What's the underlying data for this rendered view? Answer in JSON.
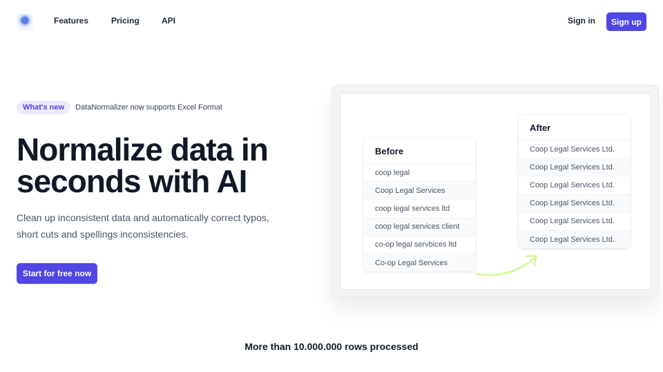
{
  "nav": {
    "links": [
      "Features",
      "Pricing",
      "API"
    ],
    "signin": "Sign in",
    "signup": "Sign up"
  },
  "hero": {
    "badge": "What's new",
    "announcement": "DataNormalizer now supports Excel Format",
    "headline_lines": [
      "Normalize data in",
      "seconds with AI"
    ],
    "subtext_lines": [
      "Clean up inconsistent data and automatically correct typos,",
      "short cuts and spellings inconsistencies."
    ],
    "cta": "Start for free now"
  },
  "demo": {
    "before": {
      "title": "Before",
      "rows": [
        "coop legal",
        "Coop Legal Services",
        "coop legal services ltd",
        "coop legal services client",
        "co-op legal servbices ltd",
        "Co-op Legal Services"
      ]
    },
    "after": {
      "title": "After",
      "rows": [
        "Coop Legal Services Ltd.",
        "Coop Legal Services Ltd.",
        "Coop Legal Services Ltd.",
        "Coop Legal Services Ltd.",
        "Coop Legal Services Ltd.",
        "Coop Legal Services Ltd."
      ]
    },
    "arrow_color": "#d9f99d"
  },
  "stats": {
    "rows_processed": "More than 10.000.000 rows processed"
  },
  "colors": {
    "accent": "#4f46e5",
    "badge_bg": "#eceafd"
  }
}
